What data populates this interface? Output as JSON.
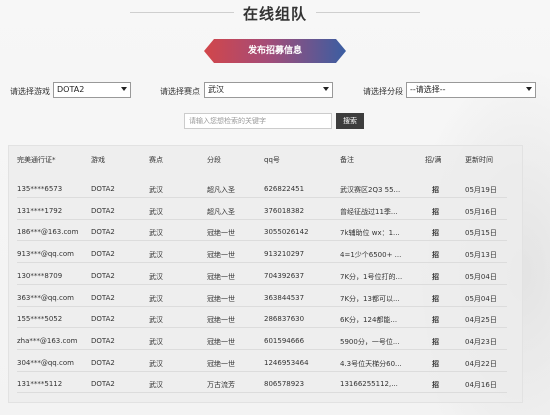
{
  "page": {
    "title": "在线组队"
  },
  "publish_button": {
    "label": "发布招募信息"
  },
  "filters": {
    "game": {
      "label": "请选择游戏",
      "value": "DOTA2"
    },
    "venue": {
      "label": "请选择赛点",
      "value": "武汉"
    },
    "segment": {
      "label": "请选择分段",
      "value": "--请选择--"
    }
  },
  "search": {
    "placeholder": "请输入您想检索的关键字",
    "button": "搜索"
  },
  "table": {
    "headers": [
      "完美通行证*",
      "游戏",
      "赛点",
      "分段",
      "qq号",
      "备注",
      "招/满",
      "更新时间"
    ],
    "rows": [
      {
        "id": "135****6573",
        "game": "DOTA2",
        "venue": "武汉",
        "seg": "超凡入圣",
        "qq": "626822451",
        "note": "武汉赛区2Q3 55...",
        "status": "招",
        "date": "05月19日"
      },
      {
        "id": "131****1792",
        "game": "DOTA2",
        "venue": "武汉",
        "seg": "超凡入圣",
        "qq": "376018382",
        "note": "曾经征战过11季...",
        "status": "招",
        "date": "05月16日"
      },
      {
        "id": "186***@163.com",
        "game": "DOTA2",
        "venue": "武汉",
        "seg": "冠绝一世",
        "qq": "3055026142",
        "note": "7k辅助位 wx：1...",
        "status": "招",
        "date": "05月15日"
      },
      {
        "id": "913***@qq.com",
        "game": "DOTA2",
        "venue": "武汉",
        "seg": "冠绝一世",
        "qq": "913210297",
        "note": "4=1少个6500+ ...",
        "status": "招",
        "date": "05月13日"
      },
      {
        "id": "130****8709",
        "game": "DOTA2",
        "venue": "武汉",
        "seg": "冠绝一世",
        "qq": "704392637",
        "note": "7K分，1号位打的...",
        "status": "招",
        "date": "05月04日"
      },
      {
        "id": "363***@qq.com",
        "game": "DOTA2",
        "venue": "武汉",
        "seg": "冠绝一世",
        "qq": "363844537",
        "note": "7K分，13都可以...",
        "status": "招",
        "date": "05月04日"
      },
      {
        "id": "155****5052",
        "game": "DOTA2",
        "venue": "武汉",
        "seg": "冠绝一世",
        "qq": "286837630",
        "note": "6K分，124都能...",
        "status": "招",
        "date": "04月25日"
      },
      {
        "id": "zha***@163.com",
        "game": "DOTA2",
        "venue": "武汉",
        "seg": "冠绝一世",
        "qq": "601594666",
        "note": "5900分，一号位...",
        "status": "招",
        "date": "04月23日"
      },
      {
        "id": "304***@qq.com",
        "game": "DOTA2",
        "venue": "武汉",
        "seg": "冠绝一世",
        "qq": "1246953464",
        "note": "4.3号位天梯分60...",
        "status": "招",
        "date": "04月22日"
      },
      {
        "id": "131****5112",
        "game": "DOTA2",
        "venue": "武汉",
        "seg": "万古流芳",
        "qq": "806578923",
        "note": "13166255112,...",
        "status": "招",
        "date": "04月16日"
      }
    ]
  },
  "colors": {
    "accent_green": "#2b9a3e",
    "button_red": "#d2464a",
    "button_blue": "#3a5ea2"
  }
}
